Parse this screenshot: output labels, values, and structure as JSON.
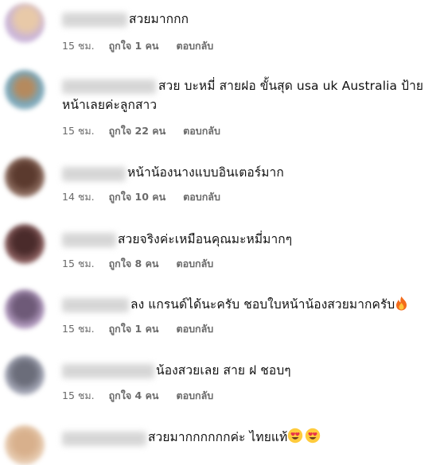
{
  "comments": [
    {
      "text": "สวยมากกก",
      "time": "15 ชม.",
      "like_label": "ถูกใจ",
      "likes": "1 คน",
      "reply_label": "ตอบกลับ",
      "emoji": []
    },
    {
      "text": "สวย บะหมี่ สายฝอ ขั้นสุด usa uk Australia ป้าย",
      "text2": "หน้าเลยค่ะลูกสาว",
      "time": "15 ชม.",
      "like_label": "ถูกใจ",
      "likes": "22 คน",
      "reply_label": "ตอบกลับ",
      "emoji": []
    },
    {
      "text": "หน้าน้องนางแบบอินเตอร์มาก",
      "time": "14 ชม.",
      "like_label": "ถูกใจ",
      "likes": "10 คน",
      "reply_label": "ตอบกลับ",
      "emoji": []
    },
    {
      "text": "สวยจริงค่ะเหมือนคุณมะหมี่มากๆ",
      "time": "15 ชม.",
      "like_label": "ถูกใจ",
      "likes": "8 คน",
      "reply_label": "ตอบกลับ",
      "emoji": []
    },
    {
      "text": "ลง แกรนด์ได้นะครับ ชอบใบหน้าน้องสวยมากครับ",
      "time": "15 ชม.",
      "like_label": "ถูกใจ",
      "likes": "1 คน",
      "reply_label": "ตอบกลับ",
      "emoji": [
        "fire-emoji"
      ]
    },
    {
      "text": "น้องสวยเลย สาย ฝ ชอบๆ",
      "time": "15 ชม.",
      "like_label": "ถูกใจ",
      "likes": "4 คน",
      "reply_label": "ตอบกลับ",
      "emoji": []
    },
    {
      "text": "สวยมากกกกกกค่ะ ไทยแท้",
      "emoji": [
        "heart-eyes-emoji",
        "heart-eyes-emoji"
      ]
    }
  ],
  "colors": {
    "text": "#111111",
    "meta": "#6a6a6a",
    "name_blur": "#d6d6d6"
  }
}
